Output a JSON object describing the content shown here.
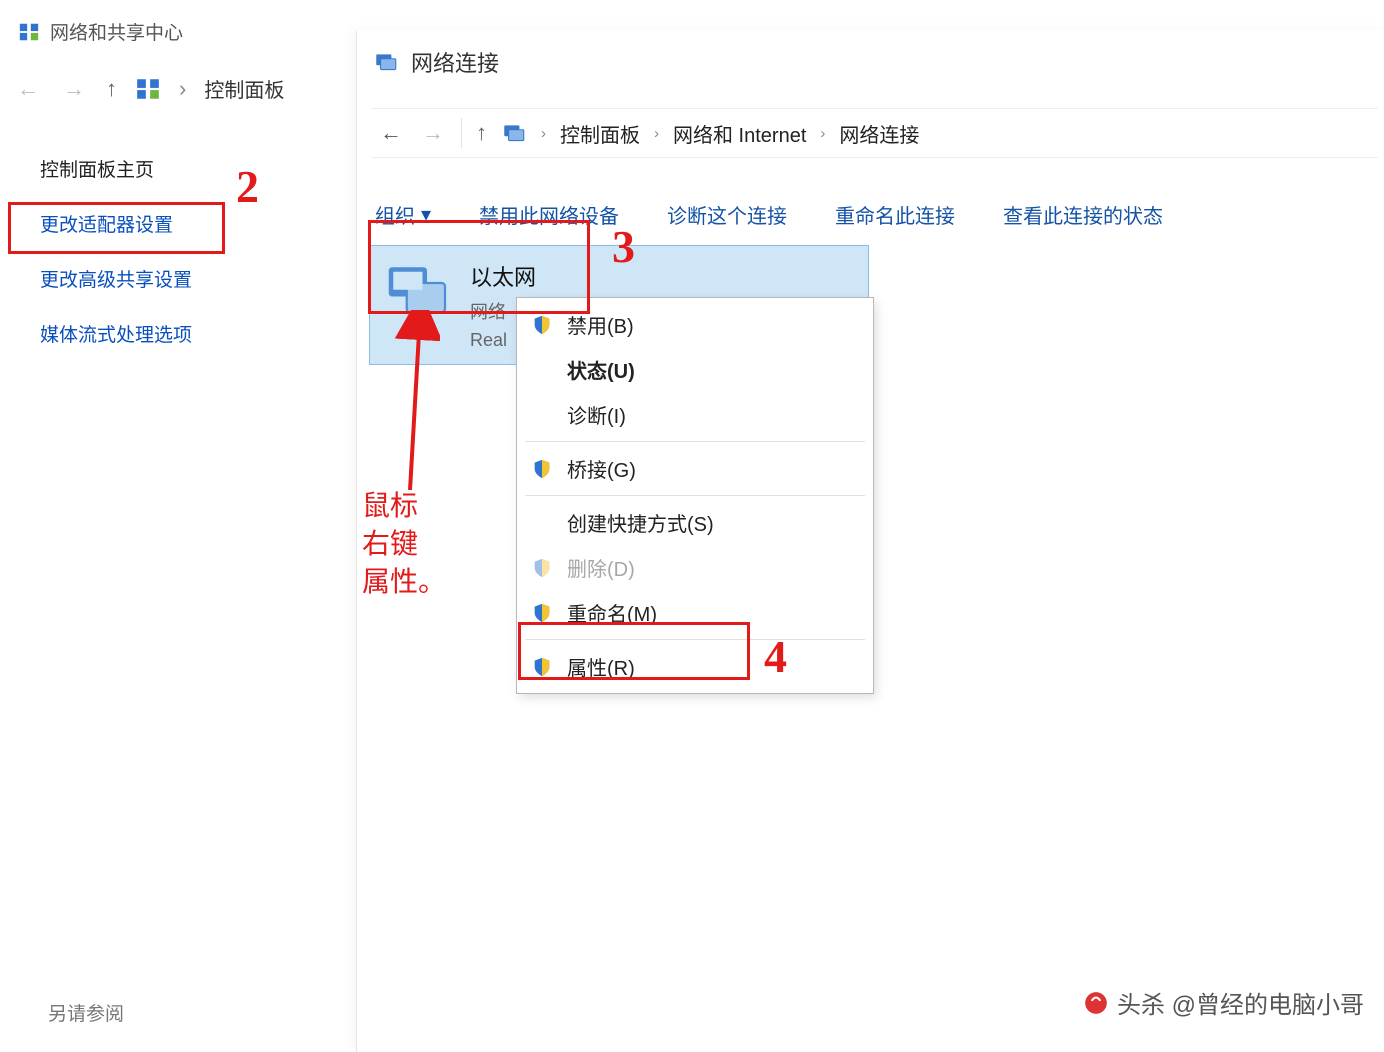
{
  "bg": {
    "title": "网络和共享中心",
    "breadcrumb": {
      "crumb1": "控制面板"
    },
    "sidebar": {
      "home": "控制面板主页",
      "adapter": "更改适配器设置",
      "advanced": "更改高级共享设置",
      "media": "媒体流式处理选项"
    },
    "also": "另请参阅"
  },
  "fg": {
    "title": "网络连接",
    "breadcrumb": {
      "c1": "控制面板",
      "c2": "网络和 Internet",
      "c3": "网络连接"
    },
    "toolbar": {
      "organize": "组织",
      "disable": "禁用此网络设备",
      "diagnose": "诊断这个连接",
      "rename": "重命名此连接",
      "view": "查看此连接的状态"
    },
    "tile": {
      "name": "以太网",
      "net": "网络",
      "adapter": "Real"
    }
  },
  "ctx": {
    "disable": "禁用(B)",
    "status": "状态(U)",
    "diagnose": "诊断(I)",
    "bridge": "桥接(G)",
    "shortcut": "创建快捷方式(S)",
    "delete": "删除(D)",
    "rename": "重命名(M)",
    "properties": "属性(R)"
  },
  "annot": {
    "n2": "2",
    "n3": "3",
    "n4": "4",
    "mouse_hint": "鼠标\n右键\n属性。"
  },
  "watermark": "头杀 @曾经的电脑小哥"
}
